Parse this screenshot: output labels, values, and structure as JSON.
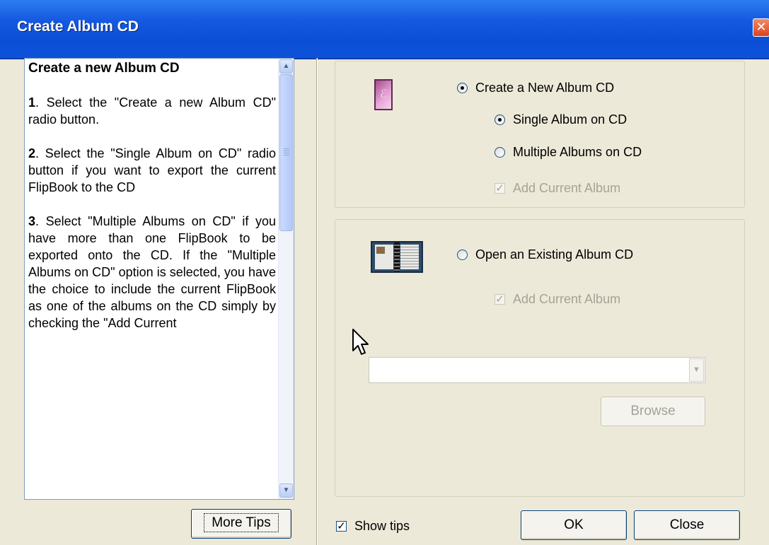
{
  "window": {
    "title": "Create Album CD",
    "close_glyph": "✕"
  },
  "tips": {
    "heading": "Create a new Album CD",
    "steps": [
      {
        "num": "1",
        "text": ". Select the \"Create a new Album CD\" radio button."
      },
      {
        "num": "2",
        "text": ". Select the \"Single Album on CD\" radio button if you want to export the current FlipBook to the CD"
      },
      {
        "num": "3",
        "text": ". Select \"Multiple Albums on CD\" if you have more than one FlipBook to be exported onto the CD. If the \"Multiple Albums on CD\" option is selected, you have the choice to include the current FlipBook as one of the albums on the CD simply by checking the \"Add Current"
      }
    ],
    "scroll_up_glyph": "▲",
    "scroll_down_glyph": "▼",
    "more_tips_label": "More Tips"
  },
  "new_cd_group": {
    "icon": "pink-album-icon",
    "icon_glyph": "ℰ",
    "create_new_label": "Create a New Album CD",
    "create_new_selected": true,
    "single_album_label": "Single Album on CD",
    "single_album_selected": true,
    "multiple_albums_label": "Multiple Albums on CD",
    "multiple_albums_selected": false,
    "add_current_label": "Add Current Album",
    "add_current_checked": true,
    "add_current_enabled": false
  },
  "existing_cd_group": {
    "icon": "photo-album-icon",
    "open_existing_label": "Open an Existing Album CD",
    "open_existing_selected": false,
    "add_current_label": "Add Current Album",
    "add_current_checked": true,
    "add_current_enabled": false,
    "combo_value": "",
    "combo_arrow_glyph": "▼",
    "browse_label": "Browse"
  },
  "footer": {
    "show_tips_label": "Show tips",
    "show_tips_checked": true,
    "ok_label": "OK",
    "close_label": "Close"
  },
  "colors": {
    "titlebar": "#0a4fd6",
    "dialog_bg": "#ece9d8",
    "disabled_text": "#a5a397"
  }
}
